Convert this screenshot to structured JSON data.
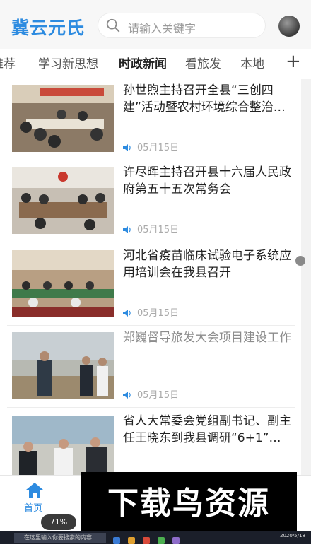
{
  "header": {
    "logo": "冀云元氏",
    "search_placeholder": "请输入关键字"
  },
  "tabs": [
    {
      "label": "推荐",
      "active": false
    },
    {
      "label": "学习新思想",
      "active": false
    },
    {
      "label": "时政新闻",
      "active": true
    },
    {
      "label": "看旅发",
      "active": false
    },
    {
      "label": "本地",
      "active": false
    }
  ],
  "add_tab_symbol": "+",
  "news": [
    {
      "title": "孙世煦主持召开全县“三创四建”活动暨农村环境综合整治…",
      "date": "05月15日",
      "dim": false
    },
    {
      "title": "许尽晖主持召开县十六届人民政府第五十五次常务会",
      "date": "05月15日",
      "dim": false
    },
    {
      "title": "河北省疫苗临床试验电子系统应用培训会在我县召开",
      "date": "05月15日",
      "dim": false
    },
    {
      "title": "郑巍督导旅发大会项目建设工作",
      "date": "05月15日",
      "dim": true
    },
    {
      "title": "省人大常委会党组副书记、副主任王晓东到我县调研“6+1”…",
      "date": "",
      "dim": false
    }
  ],
  "bottom_nav": {
    "home_label": "首页"
  },
  "status_badge": "71%",
  "watermark": "下载鸟资源",
  "taskbar": {
    "search_text": "在这里输入你要搜索的内容",
    "clock": "2020/5/18"
  },
  "colors": {
    "accent": "#2d8be0"
  }
}
